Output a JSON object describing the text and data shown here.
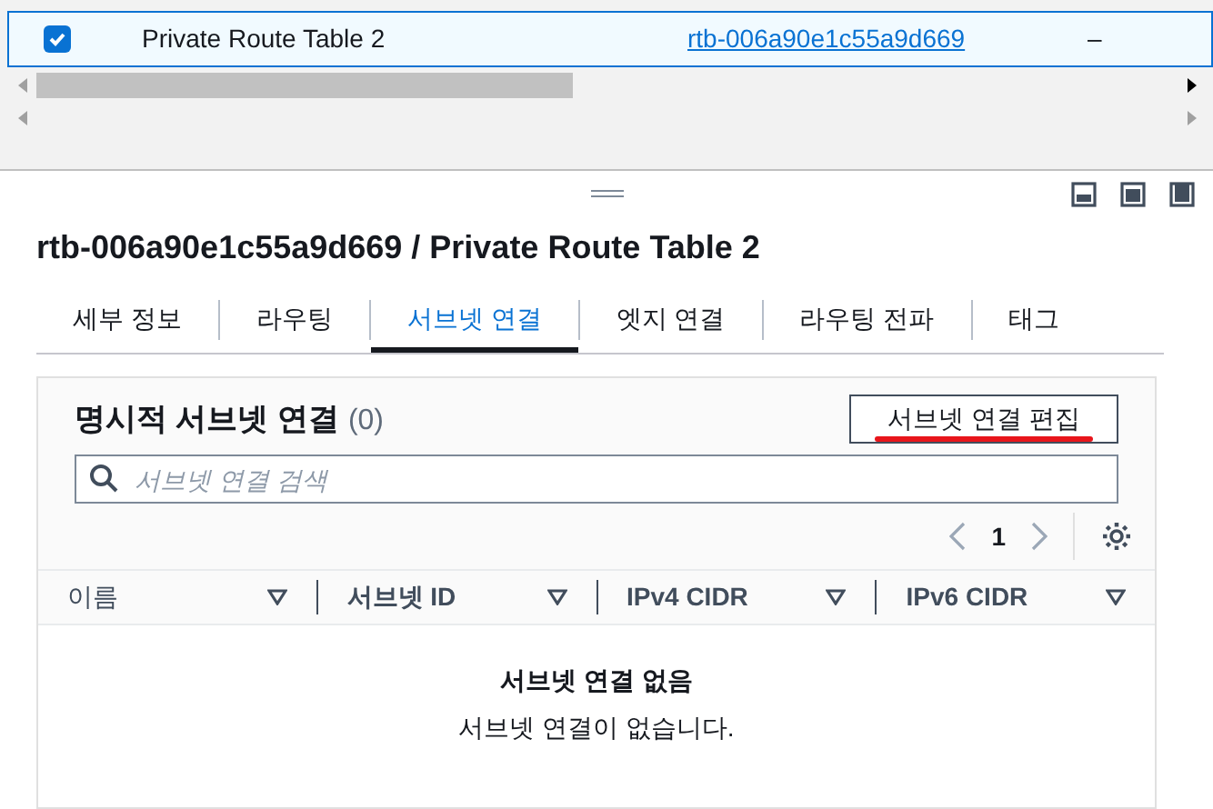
{
  "table_row": {
    "checked": true,
    "name": "Private Route Table 2",
    "id": "rtb-006a90e1c55a9d669",
    "column_4": "–"
  },
  "panel": {
    "title": "rtb-006a90e1c55a9d669 / Private Route Table 2",
    "tabs": [
      {
        "label": "세부 정보",
        "selected": false
      },
      {
        "label": "라우팅",
        "selected": false
      },
      {
        "label": "서브넷 연결",
        "selected": true
      },
      {
        "label": "엣지 연결",
        "selected": false
      },
      {
        "label": "라우팅 전파",
        "selected": false
      },
      {
        "label": "태그",
        "selected": false
      }
    ],
    "section": {
      "title": "명시적 서브넷 연결",
      "count": "(0)",
      "edit_button": {
        "label": "서브넷 연결 편집",
        "underlined": true
      },
      "search": {
        "placeholder": "서브넷 연결 검색"
      },
      "page": "1",
      "columns": [
        "이름",
        "서브넷 ID",
        "IPv4 CIDR",
        "IPv6 CIDR"
      ],
      "empty_title": "서브넷 연결 없음",
      "empty_text": "서브넷 연결이 없습니다."
    }
  }
}
